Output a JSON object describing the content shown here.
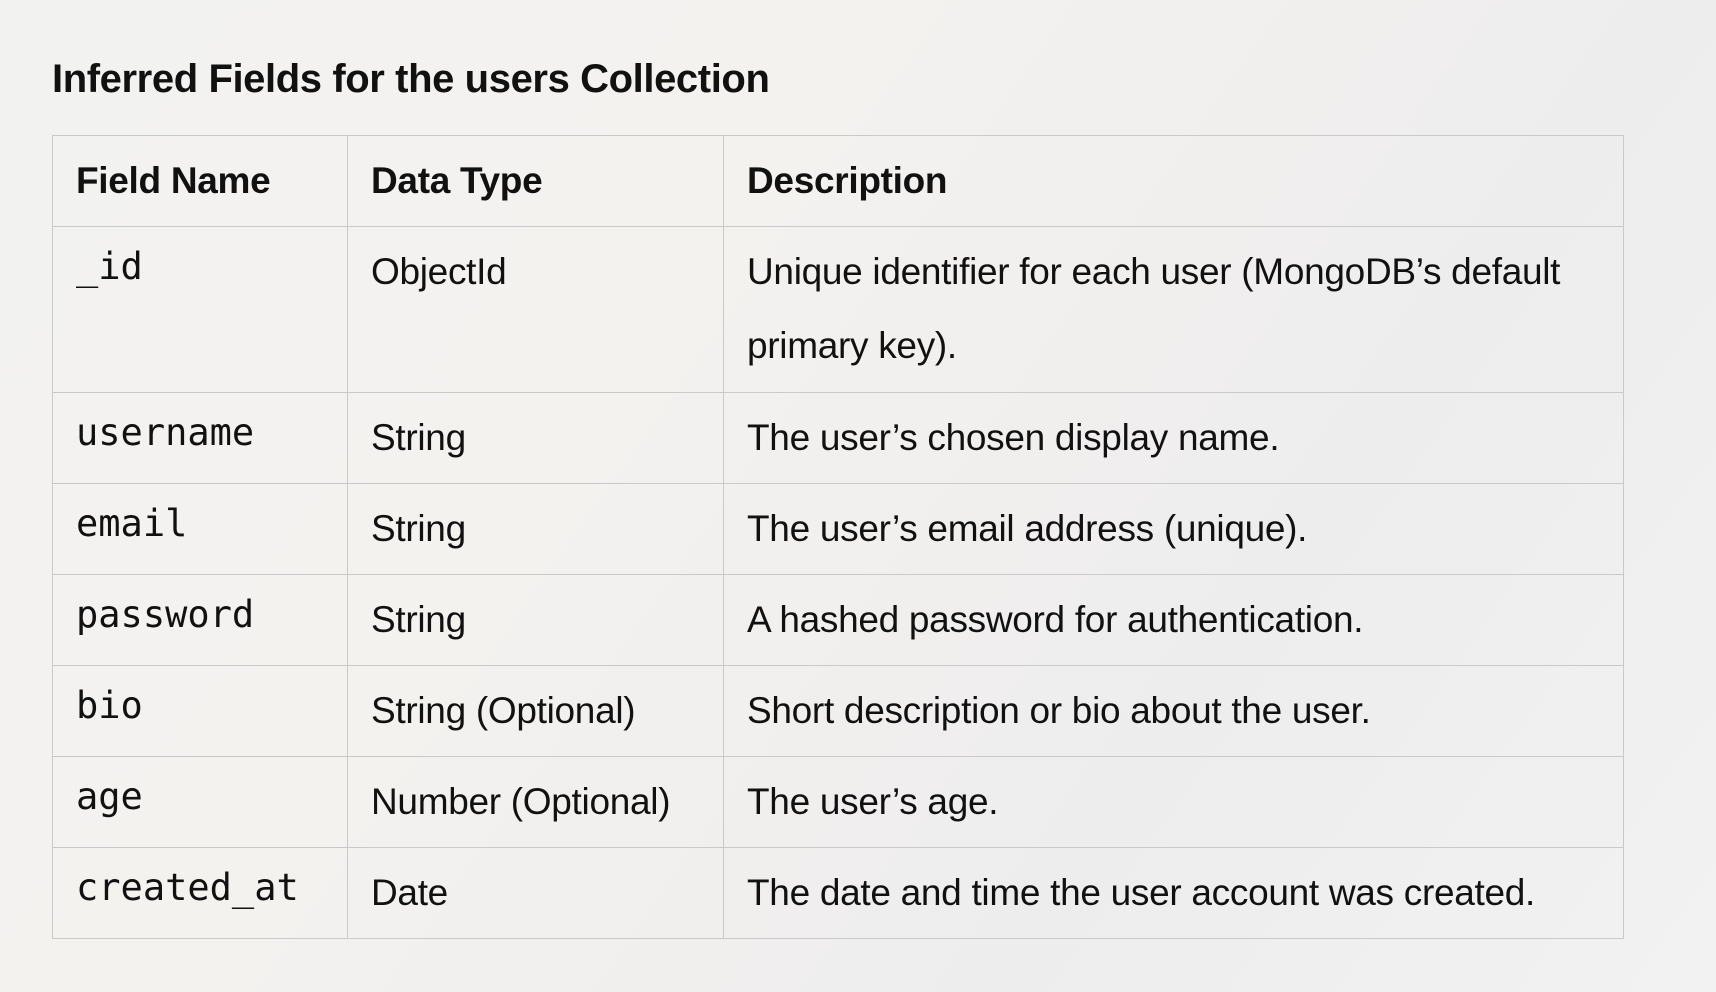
{
  "title": "Inferred Fields for the users Collection",
  "table": {
    "headers": [
      "Field Name",
      "Data Type",
      "Description"
    ],
    "rows": [
      {
        "field": "_id",
        "type": "ObjectId",
        "description": "Unique identifier for each user (MongoDB’s default primary key)."
      },
      {
        "field": "username",
        "type": "String",
        "description": "The user’s chosen display name."
      },
      {
        "field": "email",
        "type": "String",
        "description": "The user’s email address (unique)."
      },
      {
        "field": "password",
        "type": "String",
        "description": "A hashed password for authentication."
      },
      {
        "field": "bio",
        "type": "String (Optional)",
        "description": "Short description or bio about the user."
      },
      {
        "field": "age",
        "type": "Number (Optional)",
        "description": "The user’s age."
      },
      {
        "field": "created_at",
        "type": "Date",
        "description": "The date and time the user account was created."
      }
    ]
  }
}
